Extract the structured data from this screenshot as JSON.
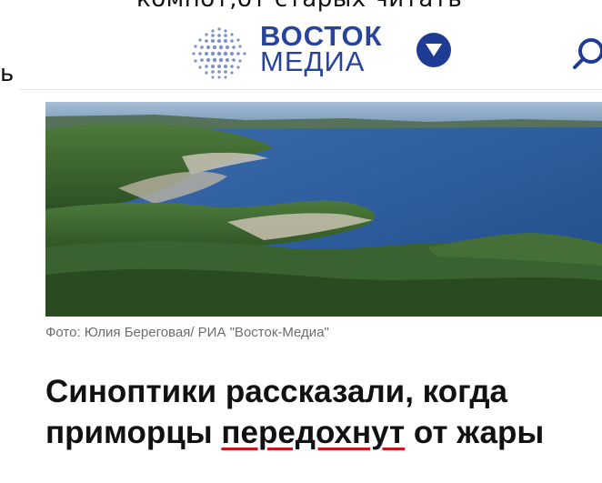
{
  "top_overflow_text": "компот,от старых читать",
  "left_overflow_glyph": "ь",
  "header": {
    "logo_line1": "ВОСТОК",
    "logo_line2": "МЕДИА",
    "brand_color": "#27449a",
    "dropdown_icon": "chevron-down-icon",
    "search_icon": "search-icon"
  },
  "article": {
    "photo_alt": "coastal landscape photo",
    "caption": "Фото: Юлия Береговая/ РИА \"Восток-Медиа\"",
    "headline_part1": "Синоптики рассказали, когда приморцы ",
    "headline_underlined": "передохнут",
    "headline_part2": " от жары",
    "underline_color": "#d0121b"
  }
}
